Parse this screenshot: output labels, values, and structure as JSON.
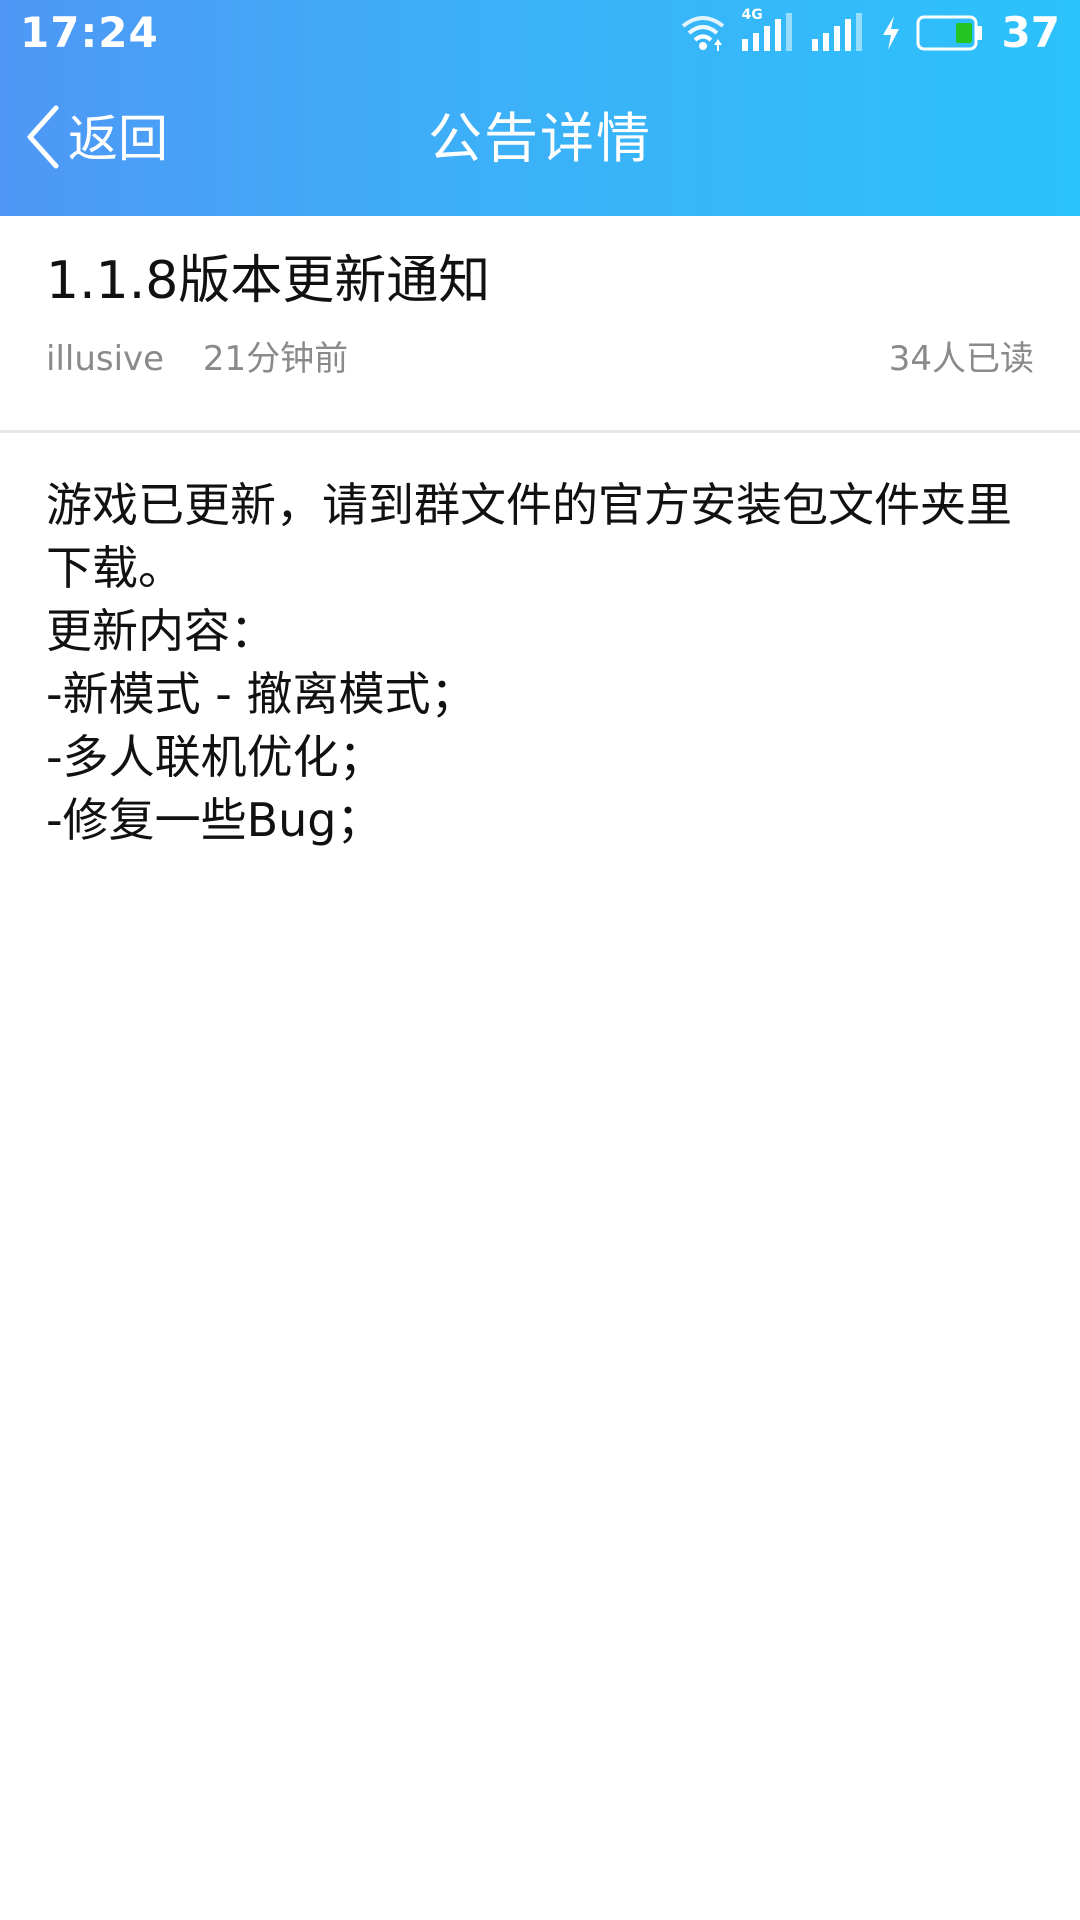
{
  "status_bar": {
    "time": "17:24",
    "network_label": "4G",
    "battery_level": "37",
    "icons": [
      "wifi-icon",
      "signal-4g-icon",
      "signal-icon",
      "charging-icon",
      "battery-icon"
    ],
    "battery_fill_color": "#22c522"
  },
  "nav": {
    "back_label": "返回",
    "title": "公告详情"
  },
  "notice": {
    "title": "1.1.8版本更新通知",
    "author": "illusive",
    "time_ago": "21分钟前",
    "read_count": "34人已读",
    "body_lines": [
      "游戏已更新，请到群文件的官方安装包文件夹里下载。",
      "更新内容：",
      "-新模式 - 撤离模式；",
      "-多人联机优化；",
      "-修复一些Bug；"
    ]
  },
  "colors": {
    "header_gradient_start": "#4f97f6",
    "header_gradient_end": "#2cc2fb",
    "meta_text": "#8a8a8a",
    "divider": "#e8e8e8"
  }
}
